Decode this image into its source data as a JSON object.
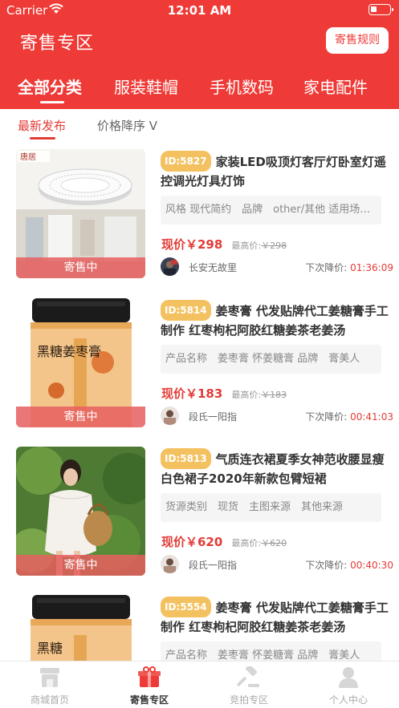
{
  "status_bar": {
    "carrier": "Carrier",
    "time": "12:01 AM"
  },
  "header": {
    "title": "寄售专区",
    "rules_button": "寄售规则"
  },
  "categories": [
    {
      "label": "全部分类",
      "active": true
    },
    {
      "label": "服装鞋帽",
      "active": false
    },
    {
      "label": "手机数码",
      "active": false
    },
    {
      "label": "家电配件",
      "active": false
    }
  ],
  "sort": {
    "latest": "最新发布",
    "price_desc": "价格降序 V"
  },
  "items": [
    {
      "id": "ID:5827",
      "title": "家装LED吸顶灯客厅灯卧室灯遥控调光灯具灯饰",
      "attrs": "风格 现代简约　品牌　other/其他 适用场所 客厅",
      "price": "现价￥298",
      "max_price_label": "最高价:",
      "max_price": "￥298",
      "seller": "长安无故里",
      "countdown_label": "下次降价:",
      "countdown": "01:36:09",
      "tag": "寄售中",
      "thumb_logo": "唐居"
    },
    {
      "id": "ID:5814",
      "title": "姜枣膏 代发贴牌代工姜糖膏手工制作 红枣枸杞阿胶红糖姜茶老姜汤",
      "attrs": "产品名称　姜枣膏 怀姜糖膏 品牌　膏美人",
      "price": "现价￥183",
      "max_price_label": "最高价:",
      "max_price": "￥183",
      "seller": "段氏一阳指",
      "countdown_label": "下次降价:",
      "countdown": "00:41:03",
      "tag": "寄售中",
      "jar_text": "黑糖姜枣膏"
    },
    {
      "id": "ID:5813",
      "title": "气质连衣裙夏季女神范收腰显瘦白色裙子2020年新款包臂短裙",
      "attrs": "货源类别　现货　主图来源　其他来源",
      "price": "现价￥620",
      "max_price_label": "最高价:",
      "max_price": "￥620",
      "seller": "段氏一阳指",
      "countdown_label": "下次降价:",
      "countdown": "00:40:30",
      "tag": "寄售中"
    },
    {
      "id": "ID:5554",
      "title": "姜枣膏 代发贴牌代工姜糖膏手工制作 红枣枸杞阿胶红糖姜茶老姜汤",
      "attrs": "产品名称　姜枣膏 怀姜糖膏 品牌　膏美人",
      "jar_text": "黑糖"
    }
  ],
  "tabbar": [
    {
      "label": "商城首页",
      "icon": "shop-icon",
      "active": false
    },
    {
      "label": "寄售专区",
      "icon": "gift-box-icon",
      "active": true
    },
    {
      "label": "竞拍专区",
      "icon": "gavel-icon",
      "active": false
    },
    {
      "label": "个人中心",
      "icon": "person-icon",
      "active": false
    }
  ],
  "colors": {
    "brand_red": "#ee3b37",
    "badge_yellow": "#f4c161"
  }
}
